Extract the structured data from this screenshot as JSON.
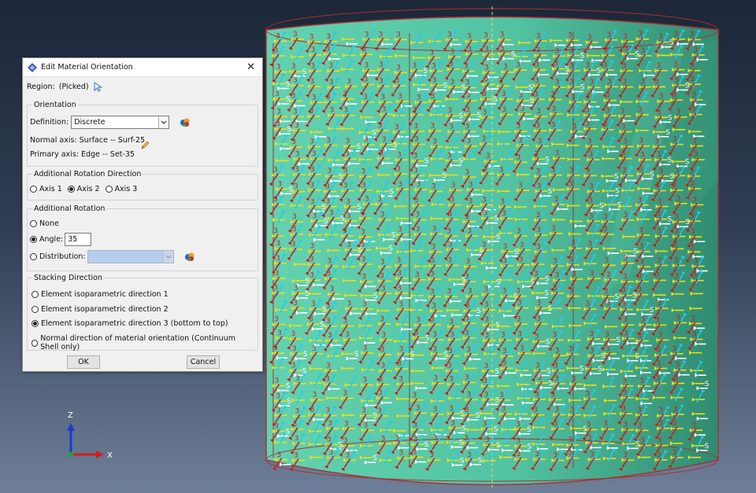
{
  "viewport": {
    "triad_labels": {
      "z": "Z",
      "x": "X"
    },
    "colors": {
      "shell": "#59c9a5",
      "edge": "#b02525",
      "axis1": "#22ccee",
      "axis2": "#f0e010",
      "axis3": "#c81d1d",
      "stack": "#ffffff"
    },
    "markers": {
      "axis1": "1",
      "axis2": "2",
      "axis3": "3",
      "stack": "S"
    }
  },
  "dialog": {
    "title": "Edit Material Orientation",
    "title_icon": "abaqus-diamond-icon",
    "close_glyph": "✕",
    "region_label": "Region:",
    "region_value": "(Picked)",
    "orientation": {
      "legend": "Orientation",
      "definition_label": "Definition:",
      "definition_value": "Discrete",
      "normal_axis": "Normal axis: Surface -- Surf-25",
      "primary_axis": "Primary axis: Edge -- Set-35"
    },
    "rotation_direction": {
      "legend": "Additional Rotation Direction",
      "options": [
        "Axis 1",
        "Axis 2",
        "Axis 3"
      ],
      "selected": "Axis 2"
    },
    "rotation": {
      "legend": "Additional Rotation",
      "none_label": "None",
      "angle_label": "Angle:",
      "angle_value": "35",
      "distribution_label": "Distribution:",
      "selected": "Angle"
    },
    "stacking": {
      "legend": "Stacking Direction",
      "options": [
        "Element isoparametric direction 1",
        "Element isoparametric direction 2",
        "Element isoparametric direction 3 (bottom to top)",
        "Normal direction of material orientation (Continuum Shell only)"
      ],
      "selected_index": 2
    },
    "ok_label": "OK",
    "cancel_label": "Cancel"
  }
}
